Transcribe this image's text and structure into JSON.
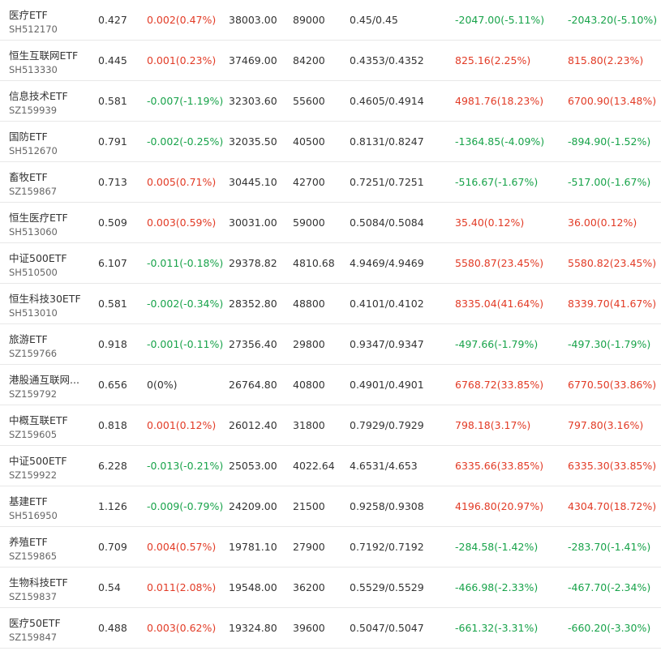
{
  "colors": {
    "up": "#e23b26",
    "down": "#18a34a",
    "flat": "#333333"
  },
  "rows": [
    {
      "name": "医疗ETF",
      "code": "SH512170",
      "price": "0.427",
      "change": "0.002(0.47%)",
      "change_dir": "up",
      "scale": "38003.00",
      "shares": "89000",
      "nav": "0.45/0.45",
      "premium1": "-2047.00(-5.11%)",
      "p1_dir": "down",
      "premium2": "-2043.20(-5.10%)",
      "p2_dir": "down"
    },
    {
      "name": "恒生互联网ETF",
      "code": "SH513330",
      "price": "0.445",
      "change": "0.001(0.23%)",
      "change_dir": "up",
      "scale": "37469.00",
      "shares": "84200",
      "nav": "0.4353/0.4352",
      "premium1": "825.16(2.25%)",
      "p1_dir": "up",
      "premium2": "815.80(2.23%)",
      "p2_dir": "up"
    },
    {
      "name": "信息技术ETF",
      "code": "SZ159939",
      "price": "0.581",
      "change": "-0.007(-1.19%)",
      "change_dir": "down",
      "scale": "32303.60",
      "shares": "55600",
      "nav": "0.4605/0.4914",
      "premium1": "4981.76(18.23%)",
      "p1_dir": "up",
      "premium2": "6700.90(13.48%)",
      "p2_dir": "up"
    },
    {
      "name": "国防ETF",
      "code": "SH512670",
      "price": "0.791",
      "change": "-0.002(-0.25%)",
      "change_dir": "down",
      "scale": "32035.50",
      "shares": "40500",
      "nav": "0.8131/0.8247",
      "premium1": "-1364.85(-4.09%)",
      "p1_dir": "down",
      "premium2": "-894.90(-1.52%)",
      "p2_dir": "down"
    },
    {
      "name": "畜牧ETF",
      "code": "SZ159867",
      "price": "0.713",
      "change": "0.005(0.71%)",
      "change_dir": "up",
      "scale": "30445.10",
      "shares": "42700",
      "nav": "0.7251/0.7251",
      "premium1": "-516.67(-1.67%)",
      "p1_dir": "down",
      "premium2": "-517.00(-1.67%)",
      "p2_dir": "down"
    },
    {
      "name": "恒生医疗ETF",
      "code": "SH513060",
      "price": "0.509",
      "change": "0.003(0.59%)",
      "change_dir": "up",
      "scale": "30031.00",
      "shares": "59000",
      "nav": "0.5084/0.5084",
      "premium1": "35.40(0.12%)",
      "p1_dir": "up",
      "premium2": "36.00(0.12%)",
      "p2_dir": "up"
    },
    {
      "name": "中证500ETF",
      "code": "SH510500",
      "price": "6.107",
      "change": "-0.011(-0.18%)",
      "change_dir": "down",
      "scale": "29378.82",
      "shares": "4810.68",
      "nav": "4.9469/4.9469",
      "premium1": "5580.87(23.45%)",
      "p1_dir": "up",
      "premium2": "5580.82(23.45%)",
      "p2_dir": "up"
    },
    {
      "name": "恒生科技30ETF",
      "code": "SH513010",
      "price": "0.581",
      "change": "-0.002(-0.34%)",
      "change_dir": "down",
      "scale": "28352.80",
      "shares": "48800",
      "nav": "0.4101/0.4102",
      "premium1": "8335.04(41.64%)",
      "p1_dir": "up",
      "premium2": "8339.70(41.67%)",
      "p2_dir": "up"
    },
    {
      "name": "旅游ETF",
      "code": "SZ159766",
      "price": "0.918",
      "change": "-0.001(-0.11%)",
      "change_dir": "down",
      "scale": "27356.40",
      "shares": "29800",
      "nav": "0.9347/0.9347",
      "premium1": "-497.66(-1.79%)",
      "p1_dir": "down",
      "premium2": "-497.30(-1.79%)",
      "p2_dir": "down"
    },
    {
      "name": "港股通互联网...",
      "code": "SZ159792",
      "price": "0.656",
      "change": "0(0%)",
      "change_dir": "flat",
      "scale": "26764.80",
      "shares": "40800",
      "nav": "0.4901/0.4901",
      "premium1": "6768.72(33.85%)",
      "p1_dir": "up",
      "premium2": "6770.50(33.86%)",
      "p2_dir": "up"
    },
    {
      "name": "中概互联ETF",
      "code": "SZ159605",
      "price": "0.818",
      "change": "0.001(0.12%)",
      "change_dir": "up",
      "scale": "26012.40",
      "shares": "31800",
      "nav": "0.7929/0.7929",
      "premium1": "798.18(3.17%)",
      "p1_dir": "up",
      "premium2": "797.80(3.16%)",
      "p2_dir": "up"
    },
    {
      "name": "中证500ETF",
      "code": "SZ159922",
      "price": "6.228",
      "change": "-0.013(-0.21%)",
      "change_dir": "down",
      "scale": "25053.00",
      "shares": "4022.64",
      "nav": "4.6531/4.653",
      "premium1": "6335.66(33.85%)",
      "p1_dir": "up",
      "premium2": "6335.30(33.85%)",
      "p2_dir": "up"
    },
    {
      "name": "基建ETF",
      "code": "SH516950",
      "price": "1.126",
      "change": "-0.009(-0.79%)",
      "change_dir": "down",
      "scale": "24209.00",
      "shares": "21500",
      "nav": "0.9258/0.9308",
      "premium1": "4196.80(20.97%)",
      "p1_dir": "up",
      "premium2": "4304.70(18.72%)",
      "p2_dir": "up"
    },
    {
      "name": "养殖ETF",
      "code": "SZ159865",
      "price": "0.709",
      "change": "0.004(0.57%)",
      "change_dir": "up",
      "scale": "19781.10",
      "shares": "27900",
      "nav": "0.7192/0.7192",
      "premium1": "-284.58(-1.42%)",
      "p1_dir": "down",
      "premium2": "-283.70(-1.41%)",
      "p2_dir": "down"
    },
    {
      "name": "生物科技ETF",
      "code": "SZ159837",
      "price": "0.54",
      "change": "0.011(2.08%)",
      "change_dir": "up",
      "scale": "19548.00",
      "shares": "36200",
      "nav": "0.5529/0.5529",
      "premium1": "-466.98(-2.33%)",
      "p1_dir": "down",
      "premium2": "-467.70(-2.34%)",
      "p2_dir": "down"
    },
    {
      "name": "医疗50ETF",
      "code": "SZ159847",
      "price": "0.488",
      "change": "0.003(0.62%)",
      "change_dir": "up",
      "scale": "19324.80",
      "shares": "39600",
      "nav": "0.5047/0.5047",
      "premium1": "-661.32(-3.31%)",
      "p1_dir": "down",
      "premium2": "-660.20(-3.30%)",
      "p2_dir": "down"
    }
  ]
}
